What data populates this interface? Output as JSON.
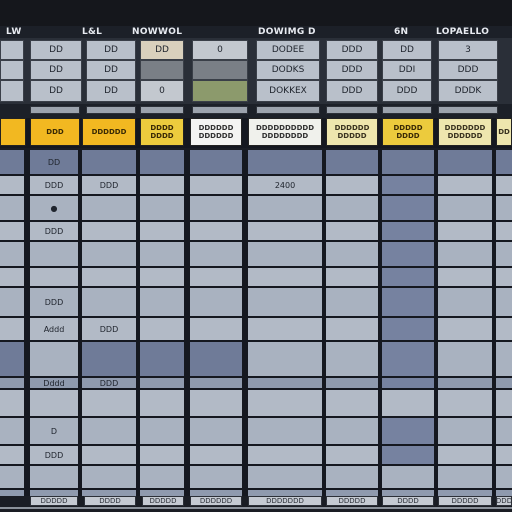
{
  "header": {
    "titles": [
      "LW",
      "L&L",
      "NOWWOL",
      "DOWIMG D",
      "6N",
      "LOPAELLO"
    ]
  },
  "panel_cells": {
    "a1": "DD",
    "b1": "DD",
    "c1": "DD",
    "d1": "0",
    "e1": "DODEE",
    "f1": "DDD",
    "g1": "DD",
    "h1": "3",
    "a2": "DD",
    "b2": "DD",
    "e2": "DODKS",
    "f2": "DDD",
    "g2": "DDI",
    "h2": "DDD",
    "a3": "DD",
    "b3": "DD",
    "c3": "0",
    "e3": "DOKKEX",
    "f3": "DDD",
    "g3": "DDD",
    "h3": "DDDK"
  },
  "column_headers": [
    {
      "line1": "",
      "line2": ""
    },
    {
      "line1": "DDD",
      "line2": ""
    },
    {
      "line1": "DDDDDD",
      "line2": ""
    },
    {
      "line1": "DDDD",
      "line2": "DDDD"
    },
    {
      "line1": "DDDDDD",
      "line2": "DDDDDD"
    },
    {
      "line1": "DDDDDDDDDD",
      "line2": "DDDDDDDD"
    },
    {
      "line1": "DDDDDD",
      "line2": "DDDDD"
    },
    {
      "line1": "DDDDD",
      "line2": "DDDD"
    },
    {
      "line1": "DDDDDDD",
      "line2": "DDDDDD"
    },
    {
      "line1": "DD",
      "line2": ""
    }
  ],
  "grid_text": {
    "r1c1": "DD",
    "r2c1": "DDD",
    "r2c2": "DDD",
    "r2c5": "2400",
    "r3c1": "●",
    "r4c1": "DDD",
    "r7c1": "DDD",
    "r8c1": "Addd",
    "r8c2": "DDD",
    "r10c1": "Dddd",
    "r10c2": "DDD",
    "r12c1": "D",
    "r13c1": "DDD"
  },
  "footer": {
    "labels": [
      "DDDDD",
      "DDDD",
      "DDDDD",
      "DDDDDD",
      "DDDDDDD",
      "DDDDD",
      "DDDD",
      "DDDDD",
      "DDD"
    ]
  },
  "colors": {
    "header_yellow": "#f2b821",
    "header_white": "#f4f4f2",
    "cell_light": "#b2bac6",
    "cell_blue": "#6f7b98",
    "background": "#151820"
  }
}
